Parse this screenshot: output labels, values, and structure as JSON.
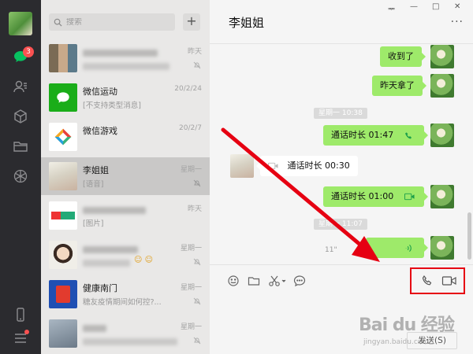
{
  "sidebar": {
    "badge_count": "3"
  },
  "search": {
    "placeholder": "搜索"
  },
  "add_button": "+",
  "conversations": [
    {
      "name": "",
      "time": "昨天",
      "preview": ""
    },
    {
      "name": "微信运动",
      "time": "20/2/24",
      "preview": "[不支持类型消息]"
    },
    {
      "name": "微信游戏",
      "time": "20/2/7",
      "preview": ""
    },
    {
      "name": "李姐姐",
      "time": "星期一",
      "preview": "[语音]"
    },
    {
      "name": "",
      "time": "昨天",
      "preview": "[图片]"
    },
    {
      "name": "",
      "time": "星期一",
      "preview": ""
    },
    {
      "name": "健康南门",
      "time": "星期一",
      "preview": "糖友疫情期间如何控?..."
    },
    {
      "name": "",
      "time": "星期一",
      "preview": ""
    }
  ],
  "chat": {
    "title": "李姐姐",
    "window_controls": {
      "pin": "ᆓ",
      "minimize": "—",
      "maximize": "□",
      "close": "✕"
    },
    "more": "···",
    "messages": {
      "m1": "收到了",
      "m2": "昨天拿了",
      "stamp1": "星期一 10:38",
      "call1": "通话时长 01:47",
      "call2": "通话时长 00:30",
      "call3": "通话时长 01:00",
      "stamp2": "星期一 11:07",
      "voice_duration": "11\""
    },
    "send_button": "发送(S)"
  },
  "watermark": {
    "logo": "Bai du 经验",
    "url": "jingyan.baidu.com"
  },
  "colors": {
    "accent_green": "#9eea6a",
    "annotation_red": "#e60012",
    "rail_bg": "#2b2b2f"
  }
}
